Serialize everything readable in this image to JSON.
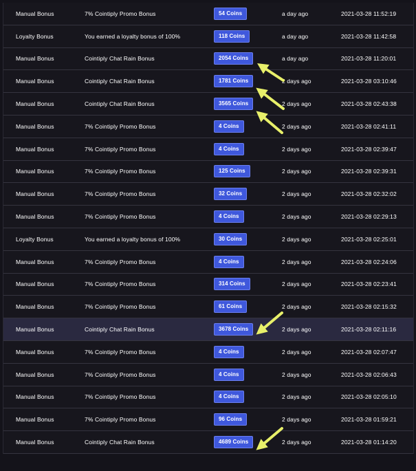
{
  "rows": [
    {
      "type": "Manual Bonus",
      "desc": "7% Cointiply Promo Bonus",
      "amount": "54 Coins",
      "ago": "a day ago",
      "date": "2021-03-28 11:52:19"
    },
    {
      "type": "Loyalty Bonus",
      "desc": "You earned a loyalty bonus of 100%",
      "amount": "118 Coins",
      "ago": "a day ago",
      "date": "2021-03-28 11:42:58"
    },
    {
      "type": "Manual Bonus",
      "desc": "Cointiply Chat Rain Bonus",
      "amount": "2054 Coins",
      "ago": "a day ago",
      "date": "2021-03-28 11:20:01"
    },
    {
      "type": "Manual Bonus",
      "desc": "Cointiply Chat Rain Bonus",
      "amount": "1781 Coins",
      "ago": "2 days ago",
      "date": "2021-03-28 03:10:46"
    },
    {
      "type": "Manual Bonus",
      "desc": "Cointiply Chat Rain Bonus",
      "amount": "3565 Coins",
      "ago": "2 days ago",
      "date": "2021-03-28 02:43:38"
    },
    {
      "type": "Manual Bonus",
      "desc": "7% Cointiply Promo Bonus",
      "amount": "4 Coins",
      "ago": "2 days ago",
      "date": "2021-03-28 02:41:11"
    },
    {
      "type": "Manual Bonus",
      "desc": "7% Cointiply Promo Bonus",
      "amount": "4 Coins",
      "ago": "2 days ago",
      "date": "2021-03-28 02:39:47"
    },
    {
      "type": "Manual Bonus",
      "desc": "7% Cointiply Promo Bonus",
      "amount": "125 Coins",
      "ago": "2 days ago",
      "date": "2021-03-28 02:39:31"
    },
    {
      "type": "Manual Bonus",
      "desc": "7% Cointiply Promo Bonus",
      "amount": "32 Coins",
      "ago": "2 days ago",
      "date": "2021-03-28 02:32:02"
    },
    {
      "type": "Manual Bonus",
      "desc": "7% Cointiply Promo Bonus",
      "amount": "4 Coins",
      "ago": "2 days ago",
      "date": "2021-03-28 02:29:13"
    },
    {
      "type": "Loyalty Bonus",
      "desc": "You earned a loyalty bonus of 100%",
      "amount": "30 Coins",
      "ago": "2 days ago",
      "date": "2021-03-28 02:25:01"
    },
    {
      "type": "Manual Bonus",
      "desc": "7% Cointiply Promo Bonus",
      "amount": "4 Coins",
      "ago": "2 days ago",
      "date": "2021-03-28 02:24:06"
    },
    {
      "type": "Manual Bonus",
      "desc": "7% Cointiply Promo Bonus",
      "amount": "314 Coins",
      "ago": "2 days ago",
      "date": "2021-03-28 02:23:41"
    },
    {
      "type": "Manual Bonus",
      "desc": "7% Cointiply Promo Bonus",
      "amount": "61 Coins",
      "ago": "2 days ago",
      "date": "2021-03-28 02:15:32"
    },
    {
      "type": "Manual Bonus",
      "desc": "Cointiply Chat Rain Bonus",
      "amount": "3678 Coins",
      "ago": "2 days ago",
      "date": "2021-03-28 02:11:16"
    },
    {
      "type": "Manual Bonus",
      "desc": "7% Cointiply Promo Bonus",
      "amount": "4 Coins",
      "ago": "2 days ago",
      "date": "2021-03-28 02:07:47"
    },
    {
      "type": "Manual Bonus",
      "desc": "7% Cointiply Promo Bonus",
      "amount": "4 Coins",
      "ago": "2 days ago",
      "date": "2021-03-28 02:06:43"
    },
    {
      "type": "Manual Bonus",
      "desc": "7% Cointiply Promo Bonus",
      "amount": "4 Coins",
      "ago": "2 days ago",
      "date": "2021-03-28 02:05:10"
    },
    {
      "type": "Manual Bonus",
      "desc": "7% Cointiply Promo Bonus",
      "amount": "96 Coins",
      "ago": "2 days ago",
      "date": "2021-03-28 01:59:21"
    },
    {
      "type": "Manual Bonus",
      "desc": "Cointiply Chat Rain Bonus",
      "amount": "4689 Coins",
      "ago": "2 days ago",
      "date": "2021-03-28 01:14:20"
    }
  ],
  "colors": {
    "badge": "#3f58dc",
    "arrow": "#e8f06a",
    "highlight_row": "#2a2940"
  }
}
